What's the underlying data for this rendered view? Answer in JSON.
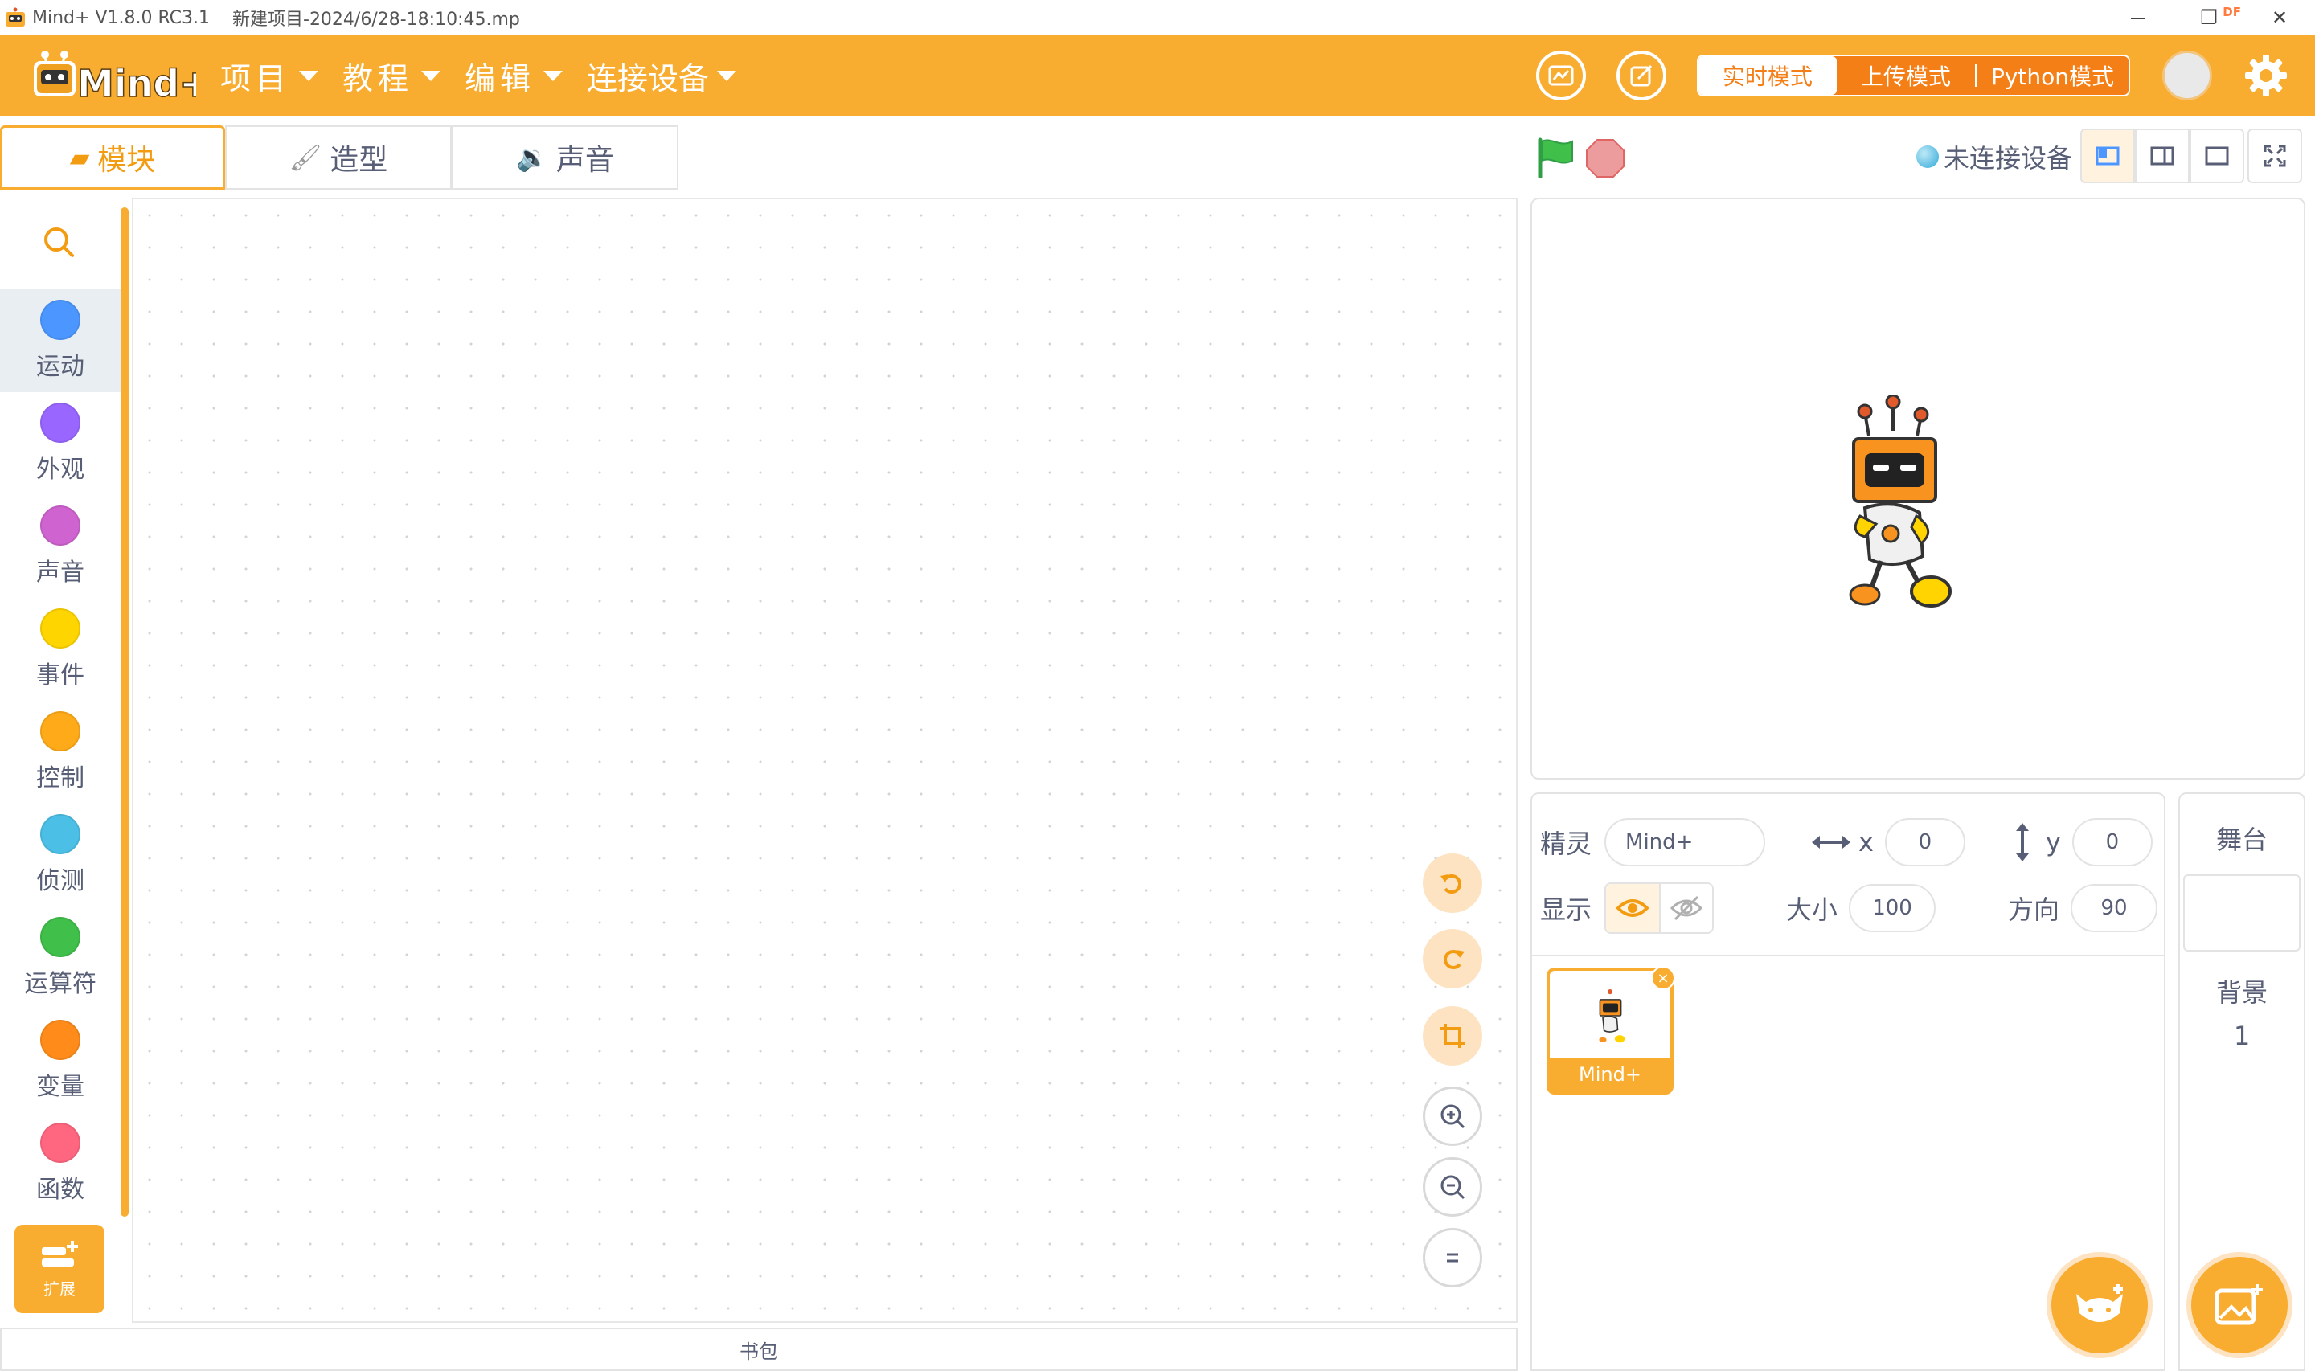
{
  "titlebar": {
    "app_title": "Mind+ V1.8.0 RC3.1",
    "file_name": "新建项目-2024/6/28-18:10:45.mp",
    "df_badge": "DF",
    "minimize": "—",
    "restore": "❐",
    "close": "✕"
  },
  "menubar": {
    "logo_text": "Mind+",
    "items": [
      {
        "label": "项目"
      },
      {
        "label": "教程"
      },
      {
        "label": "编辑"
      },
      {
        "label": "连接设备"
      }
    ],
    "modes": [
      {
        "label": "实时模式",
        "active": true
      },
      {
        "label": "上传模式",
        "active": false
      },
      {
        "label": "Python模式",
        "active": false
      }
    ],
    "icons": [
      "stats-icon",
      "edit-note-icon",
      "avatar",
      "gear-icon"
    ]
  },
  "tabs": [
    {
      "label": "模块",
      "icon": "blocks-icon",
      "active": true
    },
    {
      "label": "造型",
      "icon": "brush-icon",
      "active": false
    },
    {
      "label": "声音",
      "icon": "speaker-icon",
      "active": false
    }
  ],
  "palette": {
    "categories": [
      {
        "label": "运动",
        "color": "#4c97ff",
        "selected": true
      },
      {
        "label": "外观",
        "color": "#9966ff",
        "selected": false
      },
      {
        "label": "声音",
        "color": "#cf63cf",
        "selected": false
      },
      {
        "label": "事件",
        "color": "#ffd500",
        "selected": false
      },
      {
        "label": "控制",
        "color": "#ffab19",
        "selected": false
      },
      {
        "label": "侦测",
        "color": "#4cbfe6",
        "selected": false
      },
      {
        "label": "运算符",
        "color": "#40bf4a",
        "selected": false
      },
      {
        "label": "变量",
        "color": "#ff8c1a",
        "selected": false
      },
      {
        "label": "函数",
        "color": "#ff6680",
        "selected": false
      }
    ],
    "extension_label": "扩展"
  },
  "workspace": {
    "backpack_label": "书包"
  },
  "stage_header": {
    "connection_status": "未连接设备"
  },
  "sprite_info": {
    "sprite_label": "精灵",
    "sprite_name": "Mind+",
    "x_label": "x",
    "x_value": "0",
    "y_label": "y",
    "y_value": "0",
    "show_label": "显示",
    "size_label": "大小",
    "size_value": "100",
    "direction_label": "方向",
    "direction_value": "90"
  },
  "sprites": [
    {
      "name": "Mind+",
      "selected": true
    }
  ],
  "stage_selector": {
    "title": "舞台",
    "backdrops_label": "背景",
    "backdrops_count": "1"
  },
  "colors": {
    "accent": "#f9ad30",
    "accent_dark": "#f57f17"
  }
}
